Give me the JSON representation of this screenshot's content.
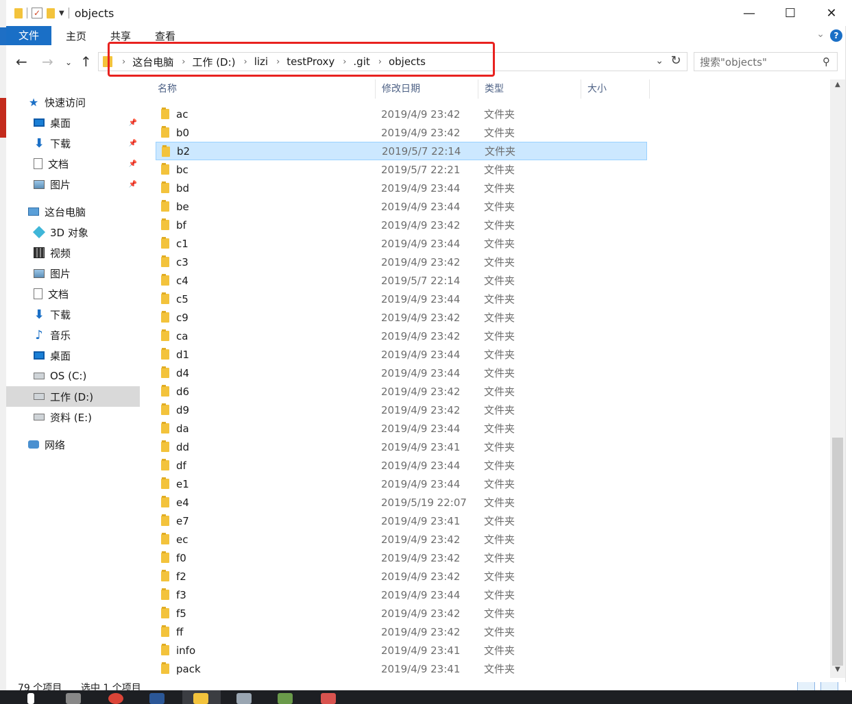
{
  "window": {
    "title": "objects",
    "controls": {
      "minimize": "—",
      "maximize": "☐",
      "close": "✕"
    }
  },
  "ribbon": {
    "tabs": [
      "文件",
      "主页",
      "共享",
      "查看"
    ],
    "help": "?"
  },
  "address": {
    "breadcrumbs": [
      "这台电脑",
      "工作 (D:)",
      "lizi",
      "testProxy",
      ".git",
      "objects"
    ],
    "search_placeholder": "搜索\"objects\""
  },
  "nav": {
    "items": [
      {
        "label": "快速访问",
        "icon": "star-icon",
        "pinned": false,
        "indent": 0
      },
      {
        "label": "桌面",
        "icon": "desktop-icon",
        "pinned": true,
        "indent": 1
      },
      {
        "label": "下载",
        "icon": "download-icon",
        "pinned": true,
        "indent": 1
      },
      {
        "label": "文档",
        "icon": "document-icon",
        "pinned": true,
        "indent": 1
      },
      {
        "label": "图片",
        "icon": "picture-icon",
        "pinned": true,
        "indent": 1
      },
      {
        "label": "这台电脑",
        "icon": "computer-icon",
        "pinned": false,
        "indent": 0
      },
      {
        "label": "3D 对象",
        "icon": "cube-icon",
        "pinned": false,
        "indent": 1
      },
      {
        "label": "视频",
        "icon": "video-icon",
        "pinned": false,
        "indent": 1
      },
      {
        "label": "图片",
        "icon": "picture-icon",
        "pinned": false,
        "indent": 1
      },
      {
        "label": "文档",
        "icon": "document-icon",
        "pinned": false,
        "indent": 1
      },
      {
        "label": "下载",
        "icon": "download-icon",
        "pinned": false,
        "indent": 1
      },
      {
        "label": "音乐",
        "icon": "music-icon",
        "pinned": false,
        "indent": 1
      },
      {
        "label": "桌面",
        "icon": "desktop-icon",
        "pinned": false,
        "indent": 1
      },
      {
        "label": "OS (C:)",
        "icon": "drive-icon",
        "pinned": false,
        "indent": 1
      },
      {
        "label": "工作 (D:)",
        "icon": "drive-icon",
        "pinned": false,
        "indent": 1,
        "selected": true
      },
      {
        "label": "资料 (E:)",
        "icon": "drive-icon",
        "pinned": false,
        "indent": 1
      },
      {
        "label": "网络",
        "icon": "network-icon",
        "pinned": false,
        "indent": 0
      }
    ]
  },
  "columns": [
    "名称",
    "修改日期",
    "类型",
    "大小"
  ],
  "files": [
    {
      "name": "ac",
      "date": "2019/4/9 23:42",
      "type": "文件夹"
    },
    {
      "name": "b0",
      "date": "2019/4/9 23:42",
      "type": "文件夹"
    },
    {
      "name": "b2",
      "date": "2019/5/7 22:14",
      "type": "文件夹",
      "selected": true
    },
    {
      "name": "bc",
      "date": "2019/5/7 22:21",
      "type": "文件夹"
    },
    {
      "name": "bd",
      "date": "2019/4/9 23:44",
      "type": "文件夹"
    },
    {
      "name": "be",
      "date": "2019/4/9 23:44",
      "type": "文件夹"
    },
    {
      "name": "bf",
      "date": "2019/4/9 23:42",
      "type": "文件夹"
    },
    {
      "name": "c1",
      "date": "2019/4/9 23:44",
      "type": "文件夹"
    },
    {
      "name": "c3",
      "date": "2019/4/9 23:42",
      "type": "文件夹"
    },
    {
      "name": "c4",
      "date": "2019/5/7 22:14",
      "type": "文件夹"
    },
    {
      "name": "c5",
      "date": "2019/4/9 23:44",
      "type": "文件夹"
    },
    {
      "name": "c9",
      "date": "2019/4/9 23:42",
      "type": "文件夹"
    },
    {
      "name": "ca",
      "date": "2019/4/9 23:42",
      "type": "文件夹"
    },
    {
      "name": "d1",
      "date": "2019/4/9 23:44",
      "type": "文件夹"
    },
    {
      "name": "d4",
      "date": "2019/4/9 23:44",
      "type": "文件夹"
    },
    {
      "name": "d6",
      "date": "2019/4/9 23:42",
      "type": "文件夹"
    },
    {
      "name": "d9",
      "date": "2019/4/9 23:42",
      "type": "文件夹"
    },
    {
      "name": "da",
      "date": "2019/4/9 23:44",
      "type": "文件夹"
    },
    {
      "name": "dd",
      "date": "2019/4/9 23:41",
      "type": "文件夹"
    },
    {
      "name": "df",
      "date": "2019/4/9 23:44",
      "type": "文件夹"
    },
    {
      "name": "e1",
      "date": "2019/4/9 23:44",
      "type": "文件夹"
    },
    {
      "name": "e4",
      "date": "2019/5/19 22:07",
      "type": "文件夹"
    },
    {
      "name": "e7",
      "date": "2019/4/9 23:41",
      "type": "文件夹"
    },
    {
      "name": "ec",
      "date": "2019/4/9 23:42",
      "type": "文件夹"
    },
    {
      "name": "f0",
      "date": "2019/4/9 23:42",
      "type": "文件夹"
    },
    {
      "name": "f2",
      "date": "2019/4/9 23:42",
      "type": "文件夹"
    },
    {
      "name": "f3",
      "date": "2019/4/9 23:44",
      "type": "文件夹"
    },
    {
      "name": "f5",
      "date": "2019/4/9 23:42",
      "type": "文件夹"
    },
    {
      "name": "ff",
      "date": "2019/4/9 23:42",
      "type": "文件夹"
    },
    {
      "name": "info",
      "date": "2019/4/9 23:41",
      "type": "文件夹"
    },
    {
      "name": "pack",
      "date": "2019/4/9 23:41",
      "type": "文件夹"
    }
  ],
  "status": {
    "item_count": "79 个项目",
    "selected": "选中 1 个项目"
  },
  "colors": {
    "accent": "#1a6fc6",
    "selection_bg": "#cce8ff",
    "folder": "#f3c33c",
    "highlight_box": "#e8221f"
  }
}
